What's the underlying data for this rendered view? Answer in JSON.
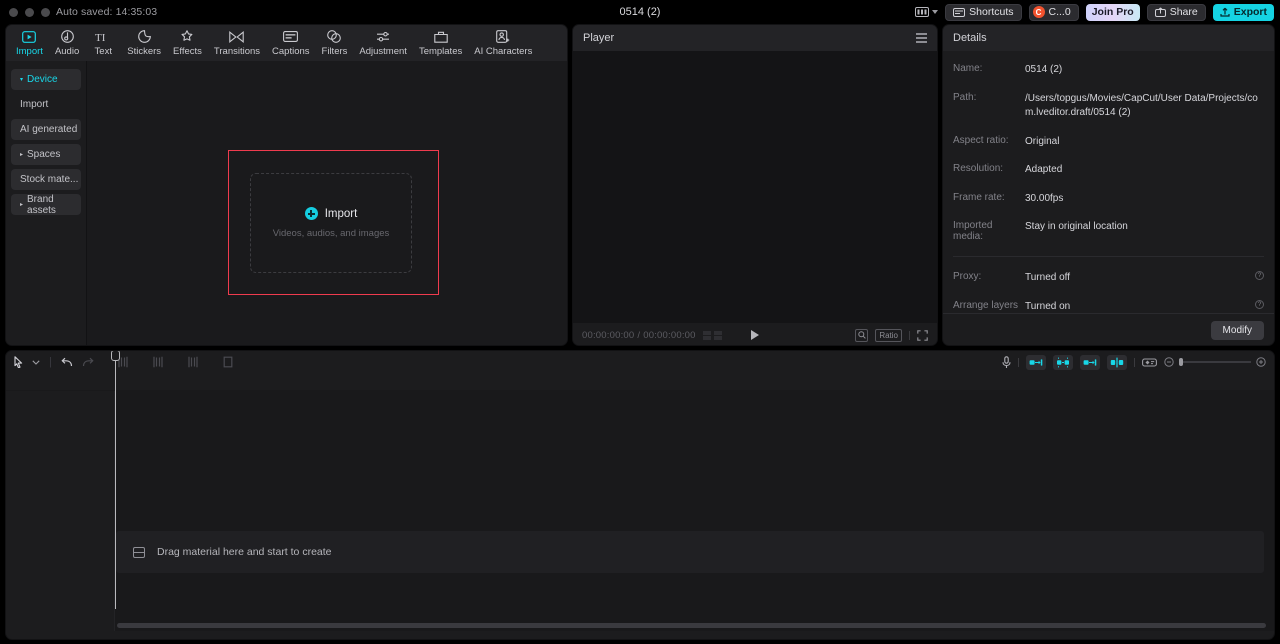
{
  "titlebar": {
    "autosave": "Auto saved: 14:35:03",
    "document_title": "0514 (2)",
    "keyboard_layout_icon": "keyboard-icon",
    "shortcuts_label": "Shortcuts",
    "credits_label": "C...0",
    "credits_badge": "C",
    "join_pro_label": "Join Pro",
    "share_label": "Share",
    "export_label": "Export"
  },
  "media": {
    "tabs": [
      {
        "label": "Import",
        "icon": "import-icon",
        "active": true
      },
      {
        "label": "Audio",
        "icon": "audio-icon",
        "active": false
      },
      {
        "label": "Text",
        "icon": "text-icon",
        "active": false
      },
      {
        "label": "Stickers",
        "icon": "stickers-icon",
        "active": false
      },
      {
        "label": "Effects",
        "icon": "effects-icon",
        "active": false
      },
      {
        "label": "Transitions",
        "icon": "transitions-icon",
        "active": false
      },
      {
        "label": "Captions",
        "icon": "captions-icon",
        "active": false
      },
      {
        "label": "Filters",
        "icon": "filters-icon",
        "active": false
      },
      {
        "label": "Adjustment",
        "icon": "adjustment-icon",
        "active": false
      },
      {
        "label": "Templates",
        "icon": "templates-icon",
        "active": false
      },
      {
        "label": "AI Characters",
        "icon": "ai-characters-icon",
        "active": false
      }
    ],
    "sidebar": [
      {
        "label": "Device",
        "expandable": true,
        "active": true
      },
      {
        "label": "Import",
        "expandable": false,
        "active": false
      },
      {
        "label": "AI generated",
        "expandable": false,
        "active": false
      },
      {
        "label": "Spaces",
        "expandable": true,
        "active": false
      },
      {
        "label": "Stock mate...",
        "expandable": false,
        "active": false
      },
      {
        "label": "Brand assets",
        "expandable": true,
        "active": false
      }
    ],
    "dropzone": {
      "title": "Import",
      "subtitle": "Videos, audios, and images",
      "highlight_color": "#ef3b4e"
    }
  },
  "player": {
    "title": "Player",
    "menu_icon": "hamburger-menu-icon",
    "current_time": "00:00:00:00",
    "total_time": "00:00:00:00",
    "time_separator": "/",
    "play_icon": "play-icon",
    "magnify_icon": "magnify-icon",
    "ratio_label": "Ratio",
    "fullscreen_icon": "fullscreen-icon"
  },
  "details": {
    "title": "Details",
    "rows": [
      {
        "key": "Name:",
        "value": "0514 (2)",
        "help": false
      },
      {
        "key": "Path:",
        "value": "/Users/topgus/Movies/CapCut/User Data/Projects/com.lveditor.draft/0514 (2)",
        "help": false
      },
      {
        "key": "Aspect ratio:",
        "value": "Original",
        "help": false
      },
      {
        "key": "Resolution:",
        "value": "Adapted",
        "help": false
      },
      {
        "key": "Frame rate:",
        "value": "30.00fps",
        "help": false
      },
      {
        "key": "Imported media:",
        "value": "Stay in original location",
        "help": false
      }
    ],
    "rows2": [
      {
        "key": "Proxy:",
        "value": "Turned off",
        "help": true
      },
      {
        "key": "Arrange layers",
        "value": "Turned on",
        "help": true
      }
    ],
    "modify_label": "Modify"
  },
  "timeline": {
    "tools_left": [
      {
        "name": "select-tool-icon"
      },
      {
        "name": "chevron-down-icon"
      },
      {
        "name": "undo-icon"
      },
      {
        "name": "redo-icon"
      },
      {
        "name": "split-icon"
      },
      {
        "name": "trim-left-icon"
      },
      {
        "name": "trim-right-icon"
      },
      {
        "name": "crop-icon"
      }
    ],
    "tools_right": [
      {
        "name": "microphone-icon",
        "highlight": false
      },
      {
        "name": "auto-cut-icon",
        "highlight": true
      },
      {
        "name": "smart-edit-icon",
        "highlight": true
      },
      {
        "name": "link-clip-icon",
        "highlight": true
      },
      {
        "name": "mirror-icon",
        "highlight": true
      },
      {
        "name": "keyframe-icon",
        "highlight": false
      }
    ],
    "zoom_out_icon": "zoom-out-icon",
    "zoom_in_icon": "zoom-in-icon",
    "empty_hint": "Drag material here and start to create",
    "empty_hint_icon": "media-placeholder-icon"
  },
  "colors": {
    "accent": "#18d7e8",
    "export": "#15d3e3",
    "highlight": "#ef3b4e",
    "panel_bg": "#1c1c1e",
    "app_bg": "#000000"
  }
}
